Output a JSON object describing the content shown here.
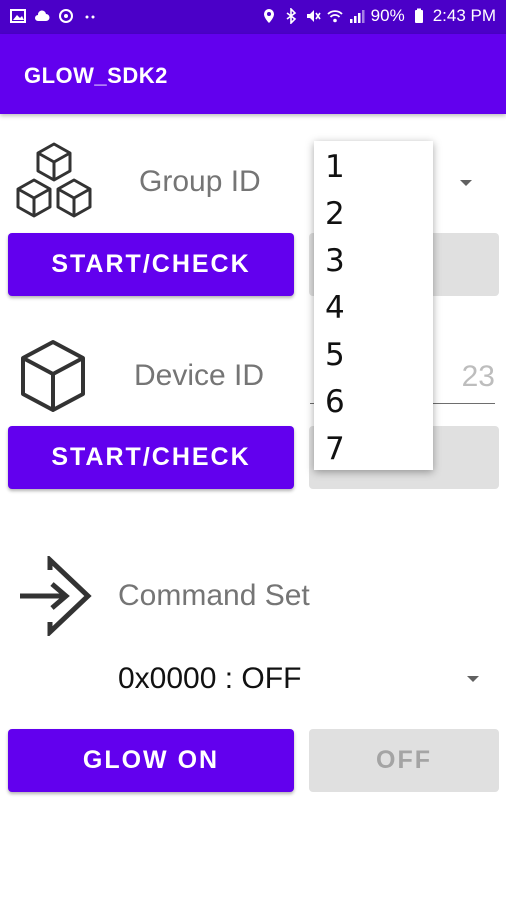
{
  "status_bar": {
    "battery": "90%",
    "time": "2:43 PM",
    "left_icons": [
      "image-icon",
      "cloud-icon",
      "sync-icon",
      "dots-icon"
    ],
    "right_icons": [
      "location-icon",
      "bluetooth-icon",
      "mute-icon",
      "wifi-icon",
      "signal-icon",
      "battery-icon"
    ]
  },
  "app_bar": {
    "title": "GLOW_SDK2"
  },
  "group": {
    "label": "Group ID",
    "start_button": "START/CHECK",
    "dropdown_options": [
      "1",
      "2",
      "3",
      "4",
      "5",
      "6",
      "7"
    ]
  },
  "device": {
    "label": "Device ID",
    "input_value_visible": "23",
    "start_button": "START/CHECK"
  },
  "command": {
    "label": "Command Set",
    "selected": "0x0000 : OFF",
    "glow_on_button": "GLOW ON",
    "off_button": "OFF"
  },
  "colors": {
    "primary": "#6200ee",
    "status_bar": "#4b00c8",
    "disabled": "#e0e0e0"
  }
}
